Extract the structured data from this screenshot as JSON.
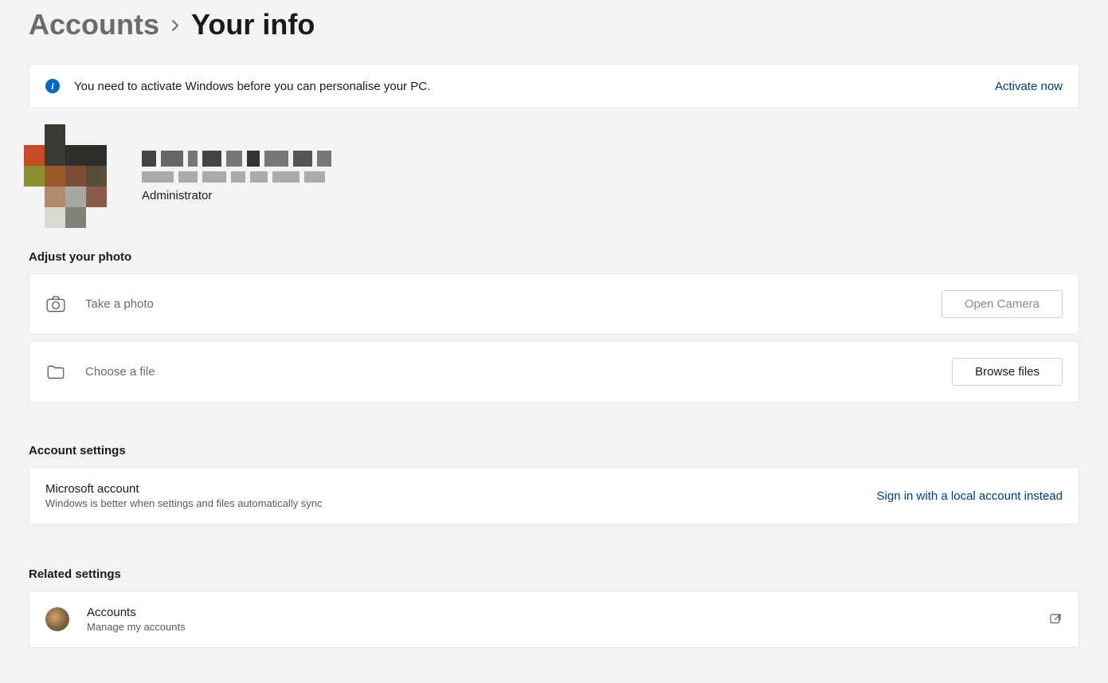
{
  "breadcrumb": {
    "parent": "Accounts",
    "current": "Your info"
  },
  "activation": {
    "message": "You need to activate Windows before you can personalise your PC.",
    "action": "Activate now"
  },
  "profile": {
    "role": "Administrator"
  },
  "photo_section": {
    "heading": "Adjust your photo",
    "take_photo": {
      "label": "Take a photo",
      "button": "Open Camera"
    },
    "choose_file": {
      "label": "Choose a file",
      "button": "Browse files"
    }
  },
  "account_settings": {
    "heading": "Account settings",
    "ms_account": {
      "title": "Microsoft account",
      "subtitle": "Windows is better when settings and files automatically sync",
      "action": "Sign in with a local account instead"
    }
  },
  "related": {
    "heading": "Related settings",
    "accounts": {
      "title": "Accounts",
      "subtitle": "Manage my accounts"
    }
  }
}
